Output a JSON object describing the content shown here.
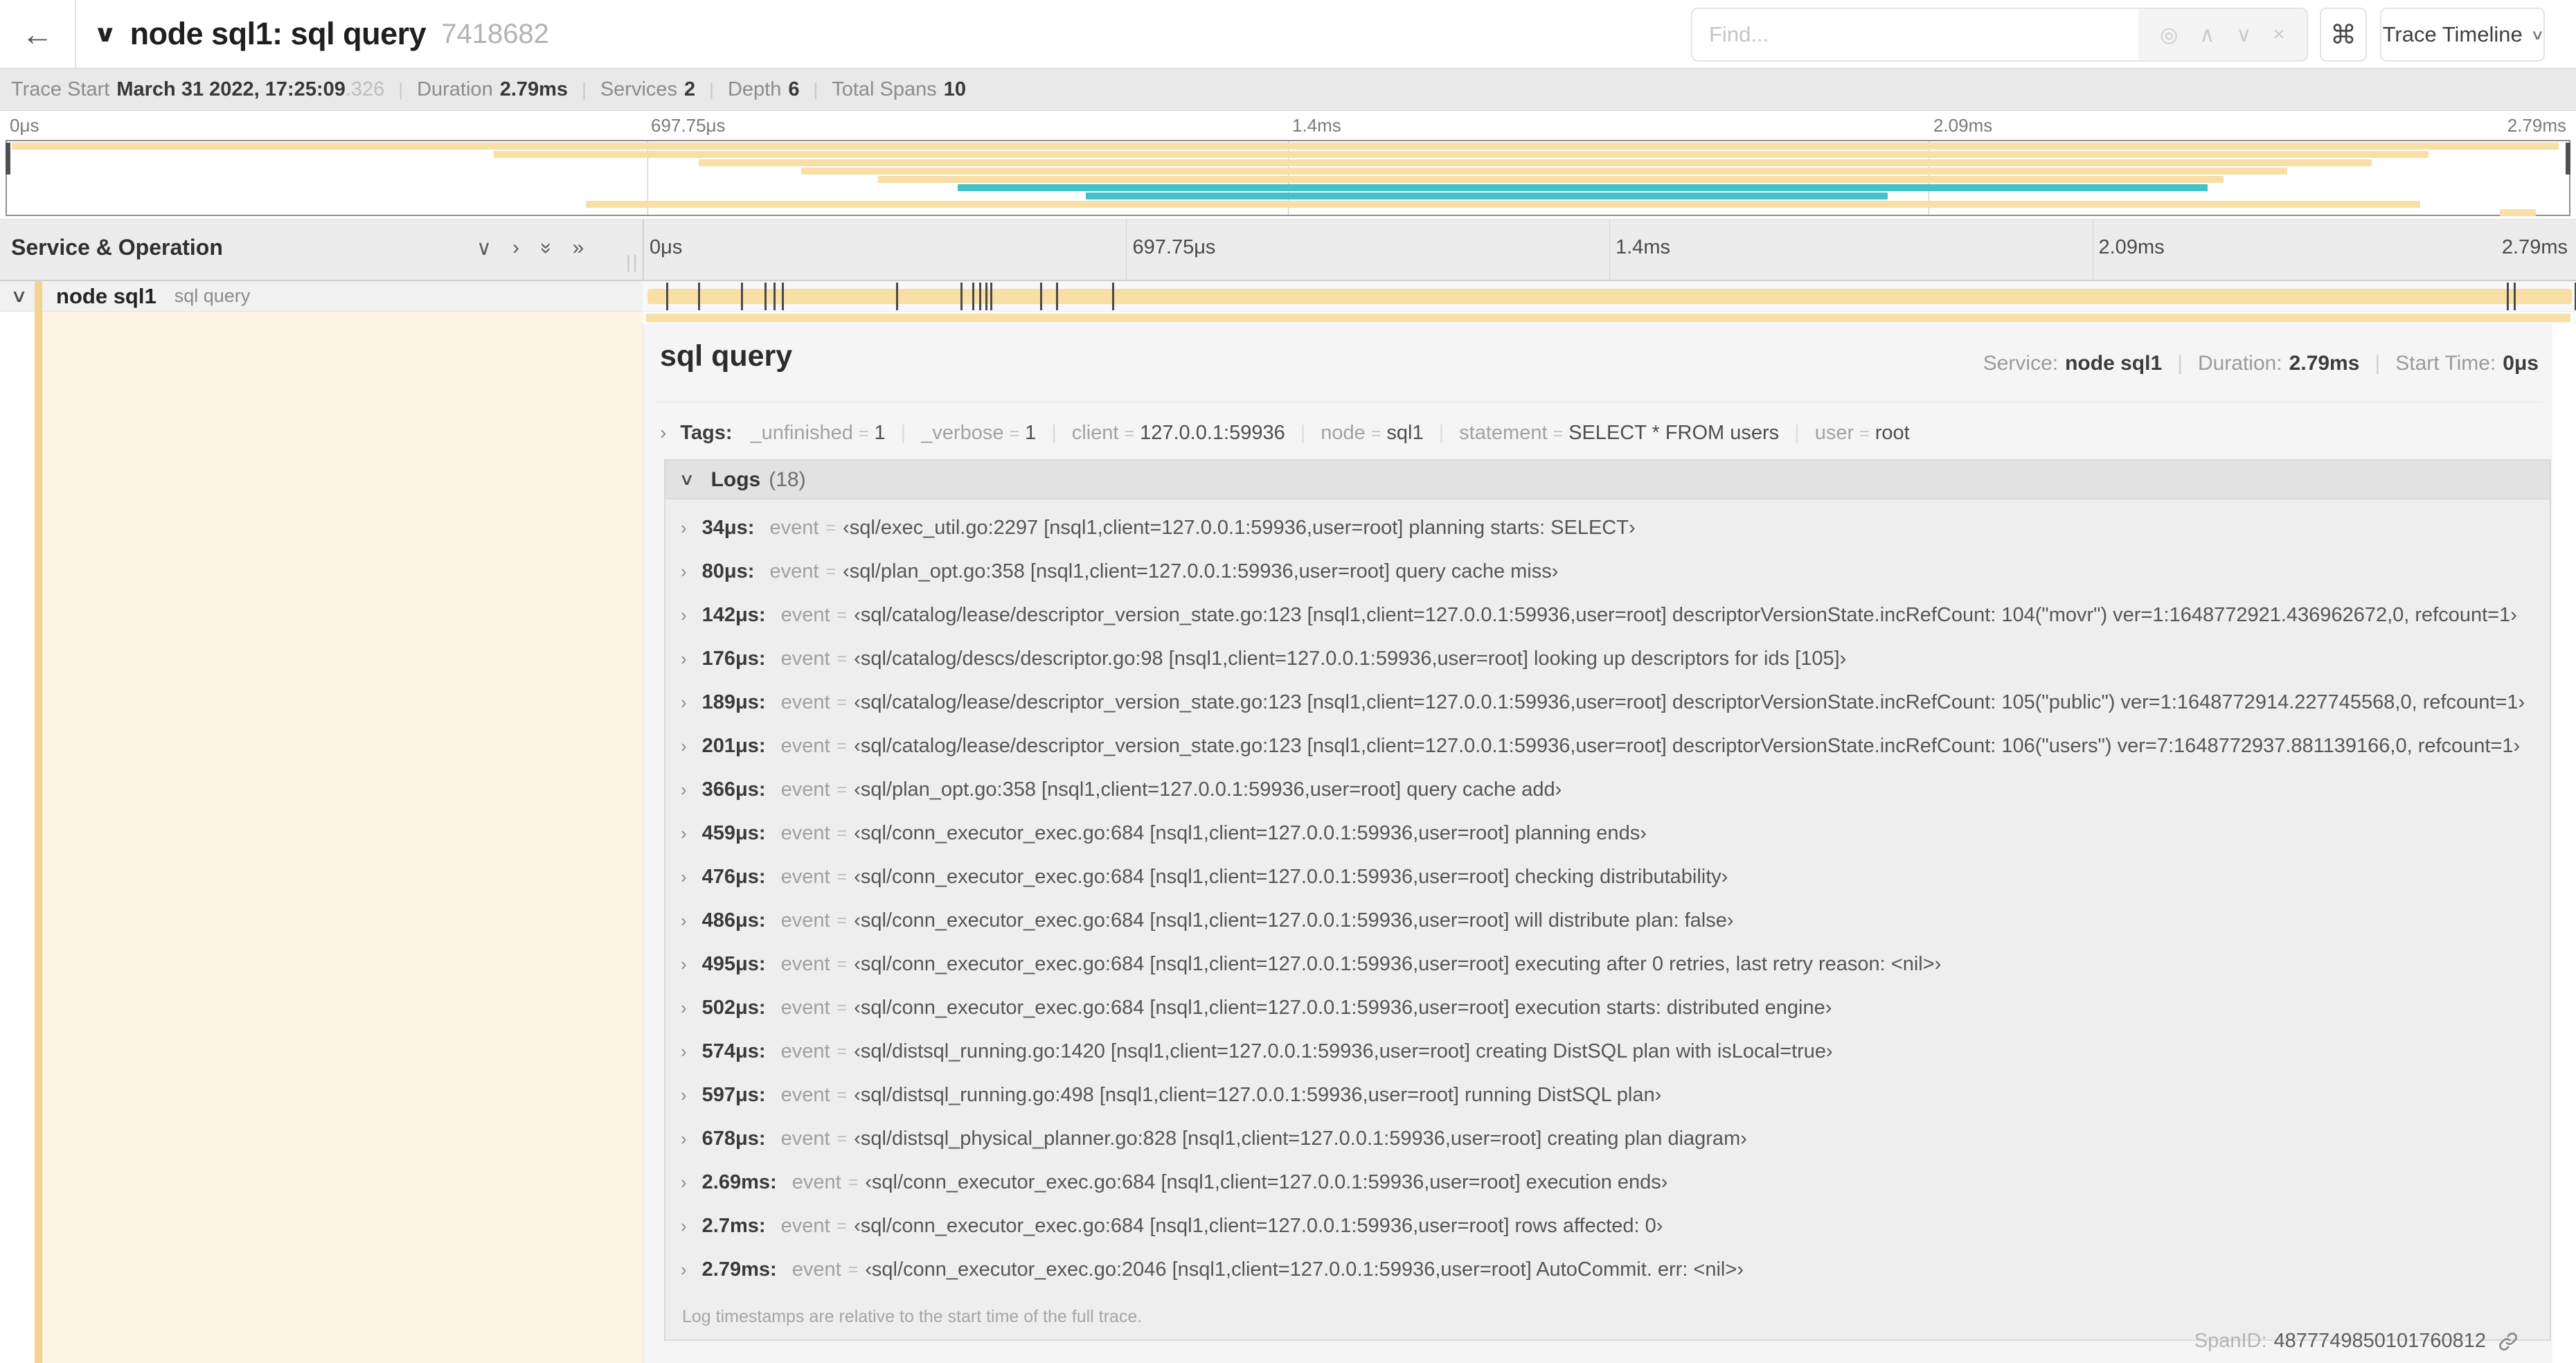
{
  "icons": {
    "back": "←",
    "collapse": "∨",
    "chev_right": "›",
    "chev_down": "∨",
    "double_right": "»",
    "find_target": "◎",
    "find_prev": "∧",
    "find_next": "∨",
    "find_clear": "×",
    "command": "⌘",
    "caret": "∨",
    "grip": "||"
  },
  "header": {
    "title": "node sql1: sql query",
    "trace_id": "7418682",
    "find_placeholder": "Find...",
    "view_label": "Trace Timeline"
  },
  "summary": {
    "items": [
      {
        "label": "Trace Start",
        "value": "March 31 2022, 17:25:09",
        "suffix": ".326"
      },
      {
        "label": "Duration",
        "value": "2.79ms"
      },
      {
        "label": "Services",
        "value": "2"
      },
      {
        "label": "Depth",
        "value": "6"
      },
      {
        "label": "Total Spans",
        "value": "10"
      }
    ]
  },
  "timeline": {
    "duration_us": 2790,
    "ticks": [
      {
        "label": "0μs",
        "pct": 0
      },
      {
        "label": "697.75μs",
        "pct": 25
      },
      {
        "label": "1.4ms",
        "pct": 50
      },
      {
        "label": "2.09ms",
        "pct": 75
      },
      {
        "label": "2.79ms",
        "pct": 100
      }
    ],
    "gridline_pcts": [
      25,
      50,
      75
    ],
    "minimap_bars": [
      {
        "row": 0,
        "start_pct": 0.2,
        "end_pct": 99.6,
        "color": "beige"
      },
      {
        "row": 1,
        "start_pct": 19.0,
        "end_pct": 94.5,
        "color": "beige"
      },
      {
        "row": 2,
        "start_pct": 27.0,
        "end_pct": 92.3,
        "color": "beige"
      },
      {
        "row": 3,
        "start_pct": 31.0,
        "end_pct": 89.0,
        "color": "beige"
      },
      {
        "row": 4,
        "start_pct": 34.0,
        "end_pct": 86.5,
        "color": "beige"
      },
      {
        "row": 5,
        "start_pct": 37.1,
        "end_pct": 85.9,
        "color": "teal"
      },
      {
        "row": 6,
        "start_pct": 42.1,
        "end_pct": 73.4,
        "color": "teal"
      },
      {
        "row": 7,
        "start_pct": 22.6,
        "end_pct": 94.2,
        "color": "beige"
      },
      {
        "row": 8,
        "start_pct": 97.3,
        "end_pct": 98.7,
        "color": "beige"
      }
    ],
    "log_marker_times_us": [
      34,
      80,
      142,
      176,
      189,
      201,
      366,
      459,
      476,
      486,
      495,
      502,
      574,
      597,
      678,
      2690,
      2700,
      2788
    ]
  },
  "tree": {
    "columns_header": "Service & Operation",
    "row": {
      "service": "node sql1",
      "operation": "sql query"
    }
  },
  "detail": {
    "title": "sql query",
    "stats": [
      {
        "label": "Service:",
        "value": "node sql1"
      },
      {
        "label": "Duration:",
        "value": "2.79ms"
      },
      {
        "label": "Start Time:",
        "value": "0μs"
      }
    ],
    "tags_label": "Tags:",
    "tags": [
      {
        "key": "_unfinished",
        "value": "1"
      },
      {
        "key": "_verbose",
        "value": "1"
      },
      {
        "key": "client",
        "value": "127.0.0.1:59936"
      },
      {
        "key": "node",
        "value": "sql1"
      },
      {
        "key": "statement",
        "value": "SELECT * FROM users"
      },
      {
        "key": "user",
        "value": "root"
      }
    ],
    "logs_label": "Logs",
    "logs_count": "(18)",
    "event_key": "event",
    "eq": "=",
    "logs": [
      {
        "time": "34μs:",
        "message": "‹sql/exec_util.go:2297 [nsql1,client=127.0.0.1:59936,user=root] planning starts: SELECT›"
      },
      {
        "time": "80μs:",
        "message": "‹sql/plan_opt.go:358 [nsql1,client=127.0.0.1:59936,user=root] query cache miss›"
      },
      {
        "time": "142μs:",
        "message": "‹sql/catalog/lease/descriptor_version_state.go:123 [nsql1,client=127.0.0.1:59936,user=root] descriptorVersionState.incRefCount: 104(\"movr\") ver=1:1648772921.436962672,0, refcount=1›"
      },
      {
        "time": "176μs:",
        "message": "‹sql/catalog/descs/descriptor.go:98 [nsql1,client=127.0.0.1:59936,user=root] looking up descriptors for ids [105]›"
      },
      {
        "time": "189μs:",
        "message": "‹sql/catalog/lease/descriptor_version_state.go:123 [nsql1,client=127.0.0.1:59936,user=root] descriptorVersionState.incRefCount: 105(\"public\") ver=1:1648772914.227745568,0, refcount=1›"
      },
      {
        "time": "201μs:",
        "message": "‹sql/catalog/lease/descriptor_version_state.go:123 [nsql1,client=127.0.0.1:59936,user=root] descriptorVersionState.incRefCount: 106(\"users\") ver=7:1648772937.881139166,0, refcount=1›"
      },
      {
        "time": "366μs:",
        "message": "‹sql/plan_opt.go:358 [nsql1,client=127.0.0.1:59936,user=root] query cache add›"
      },
      {
        "time": "459μs:",
        "message": "‹sql/conn_executor_exec.go:684 [nsql1,client=127.0.0.1:59936,user=root] planning ends›"
      },
      {
        "time": "476μs:",
        "message": "‹sql/conn_executor_exec.go:684 [nsql1,client=127.0.0.1:59936,user=root] checking distributability›"
      },
      {
        "time": "486μs:",
        "message": "‹sql/conn_executor_exec.go:684 [nsql1,client=127.0.0.1:59936,user=root] will distribute plan: false›"
      },
      {
        "time": "495μs:",
        "message": "‹sql/conn_executor_exec.go:684 [nsql1,client=127.0.0.1:59936,user=root] executing after 0 retries, last retry reason: <nil>›"
      },
      {
        "time": "502μs:",
        "message": "‹sql/conn_executor_exec.go:684 [nsql1,client=127.0.0.1:59936,user=root] execution starts: distributed engine›"
      },
      {
        "time": "574μs:",
        "message": "‹sql/distsql_running.go:1420 [nsql1,client=127.0.0.1:59936,user=root] creating DistSQL plan with isLocal=true›"
      },
      {
        "time": "597μs:",
        "message": "‹sql/distsql_running.go:498 [nsql1,client=127.0.0.1:59936,user=root] running DistSQL plan›"
      },
      {
        "time": "678μs:",
        "message": "‹sql/distsql_physical_planner.go:828 [nsql1,client=127.0.0.1:59936,user=root] creating plan diagram›"
      },
      {
        "time": "2.69ms:",
        "message": "‹sql/conn_executor_exec.go:684 [nsql1,client=127.0.0.1:59936,user=root] execution ends›"
      },
      {
        "time": "2.7ms:",
        "message": "‹sql/conn_executor_exec.go:684 [nsql1,client=127.0.0.1:59936,user=root] rows affected: 0›"
      },
      {
        "time": "2.79ms:",
        "message": "‹sql/conn_executor_exec.go:2046 [nsql1,client=127.0.0.1:59936,user=root] AutoCommit. err: <nil>›"
      }
    ],
    "footnote": "Log timestamps are relative to the start time of the full trace.",
    "span_id_label": "SpanID:",
    "span_id": "4877749850101760812"
  },
  "colors": {
    "beige": "#f7dfa6",
    "beige_strong": "#f3d292",
    "teal": "#43c2c9",
    "cream": "#fdf4e3"
  }
}
